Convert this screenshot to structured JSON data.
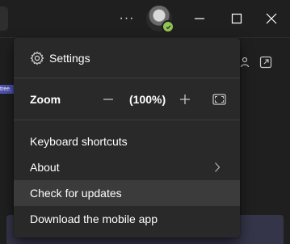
{
  "titlebar": {
    "more_label": "···",
    "more_icon": "more-horizontal-icon",
    "avatar_icon": "user-avatar",
    "presence_status": "available",
    "presence_color": "#92c353",
    "minimize_icon": "minimize-icon",
    "maximize_icon": "maximize-icon",
    "close_icon": "close-icon"
  },
  "background": {
    "banner_fragment": "tree.",
    "accent_color": "#4f52b2"
  },
  "menu": {
    "settings_label": "Settings",
    "zoom": {
      "label": "Zoom",
      "value": "(100%)",
      "decrease_icon": "minus-icon",
      "increase_icon": "plus-icon",
      "fit_icon": "fit-to-screen-icon"
    },
    "items": [
      {
        "label": "Keyboard shortcuts"
      },
      {
        "label": "About",
        "icon": "chevron-right-icon"
      },
      {
        "label": "Check for updates",
        "highlighted": true
      },
      {
        "label": "Download the mobile app"
      }
    ]
  }
}
